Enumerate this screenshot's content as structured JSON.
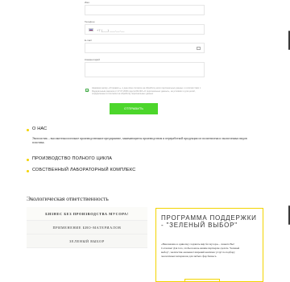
{
  "form": {
    "name_label": "Имя",
    "phone_label": "Телефон",
    "phone_mask": "+7 (___) ___-__-__",
    "email_label": "E-mail",
    "comment_label": "Комментарий",
    "consent_text": "Нажимая кнопку «Отправить», я даю свое согласие на обработку моих персональных данных, в соответствии с Федеральным законом от 27.07.2006 года №152-ФЗ «О персональных данных», на условиях и для целей, определенных в Согласии на обработку персональных данных",
    "submit_label": "ОТПРАВИТЬ"
  },
  "about": {
    "title": "О НАС",
    "description": "Экопластик – высокотехнологичное производственное предприятие, занимающиеся производством и переработкой продукции из полиэтилена и экологичных видов пластика.",
    "items": [
      "ПРОИЗВОДСТВО ПОЛНОГО ЦИКЛА",
      "СОБСТВЕННЫЙ ЛАБОРАТОРНЫЙ КОМПЛЕКС"
    ]
  },
  "ecology": {
    "title": "Экологическая ответственность",
    "menu": [
      "БИЗНЕС БЕЗ ПРОИЗВОДСТВА МУСОРА!",
      "ПРИМЕНЕНИЕ БИО-МАТЕРИАЛОВ",
      "ЗЕЛЕНЫЙ ВЫБОР"
    ],
    "card": {
      "title": "ПРОГРАММА ПОДДЕРЖКИ - \"ЗЕЛЕНЫЙ ВЫБОР\"",
      "body": "«Невозможно в одиночку создавать мир без мусора» - скажете Вы! Согласны! Для того, чтобы помочь нашим партнерам сделать \"Зеленый выбор\", экопластик оказывает широкий комплекс услуг по подбору экологичных материалов для любых сфер бизнеса."
    }
  },
  "colors": {
    "accent": "#4cd62b",
    "bullet": "#f3d400"
  }
}
